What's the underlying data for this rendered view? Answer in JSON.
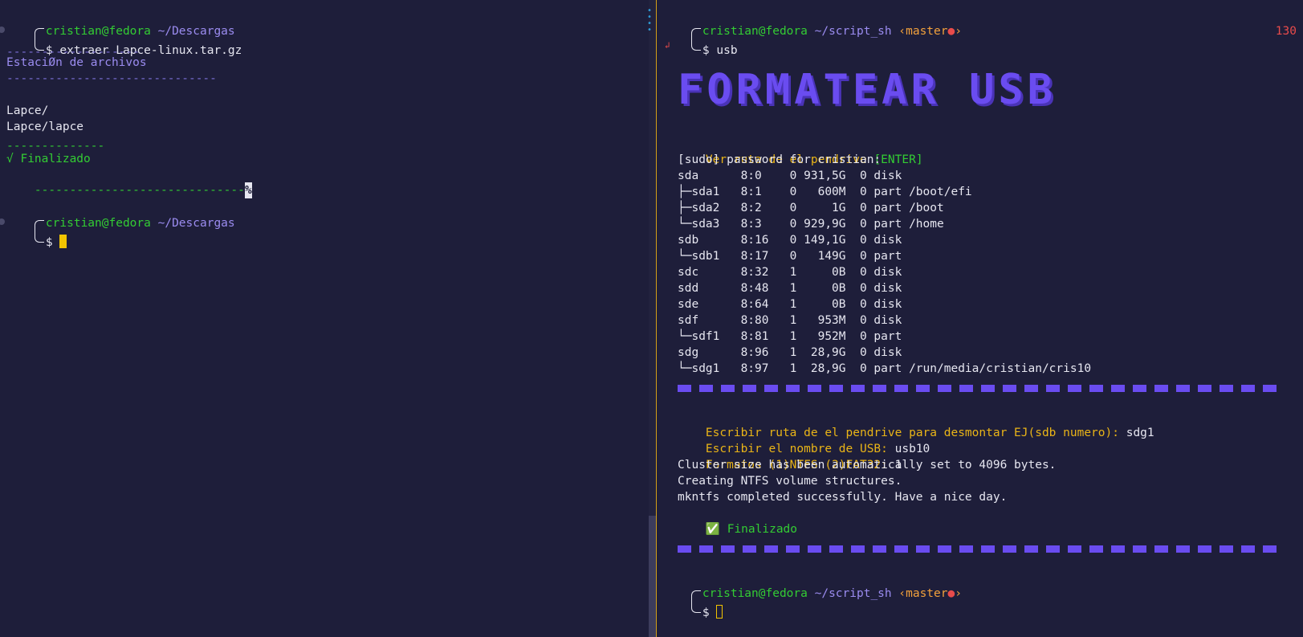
{
  "left_pane": {
    "prompt1": {
      "user_host": "cristian@fedora",
      "path": "~/Descargas",
      "symbol": "$",
      "command": "extraer Lapce-linux.tar.gz"
    },
    "rule_short": "-------------------",
    "heading": "EstaciØn de archivos",
    "rule_long": "------------------------------",
    "files": [
      "Lapce/",
      "Lapce/lapce"
    ],
    "rule_mid": "--------------",
    "done_label": "√ Finalizado",
    "rule_end": "------------------------------",
    "percent": "%",
    "prompt2": {
      "user_host": "cristian@fedora",
      "path": "~/Descargas",
      "symbol": "$"
    }
  },
  "right_pane": {
    "prompt1": {
      "user_host": "cristian@fedora",
      "path": "~/script_sh",
      "branch_open": "‹master",
      "branch_dot": "●",
      "branch_close": "›",
      "symbol": "$",
      "command": "usb",
      "exit_code": "130"
    },
    "return_arrow": "↲",
    "title": "FORMATEAR USB",
    "see_path_prompt": "Ver ruta de el pendrive ",
    "see_path_key": "[ENTER]",
    "sudo_line": "[sudo] password for cristian:",
    "lsblk_rows": [
      "sda      8:0    0 931,5G  0 disk",
      "├─sda1   8:1    0   600M  0 part /boot/efi",
      "├─sda2   8:2    0     1G  0 part /boot",
      "└─sda3   8:3    0 929,9G  0 part /home",
      "sdb      8:16   0 149,1G  0 disk",
      "└─sdb1   8:17   0   149G  0 part",
      "sdc      8:32   1     0B  0 disk",
      "sdd      8:48   1     0B  0 disk",
      "sde      8:64   1     0B  0 disk",
      "sdf      8:80   1   953M  0 disk",
      "└─sdf1   8:81   1   952M  0 part",
      "sdg      8:96   1  28,9G  0 disk",
      "└─sdg1   8:97   1  28,9G  0 part /run/media/cristian/cris10"
    ],
    "unmount_prompt": "Escribir ruta de el pendrive para desmontar EJ(sdb numero): ",
    "unmount_value": "sdg1",
    "name_prompt": "Escribir el nombre de USB: ",
    "name_value": "usb10",
    "format_prompt": "Formatos (1)NTFS (2)FAT32: ",
    "format_value": "1",
    "output_lines": [
      "Cluster size has been automatically set to 4096 bytes.",
      "Creating NTFS volume structures.",
      "mkntfs completed successfully. Have a nice day."
    ],
    "done_icon": "✅",
    "done_label": " Finalizado",
    "percent": "%",
    "prompt2": {
      "user_host": "cristian@fedora",
      "path": "~/script_sh",
      "branch_open": "‹master",
      "branch_dot": "●",
      "branch_close": "›",
      "symbol": "$"
    }
  },
  "colors": {
    "background": "#1e1e3a",
    "green": "#33cc33",
    "purple": "#9b8cf0",
    "title_purple": "#6a4cf0",
    "yellow": "#e9b417",
    "red": "#e84b4b",
    "cursor": "#f2c400",
    "divider": "#d4a017"
  }
}
